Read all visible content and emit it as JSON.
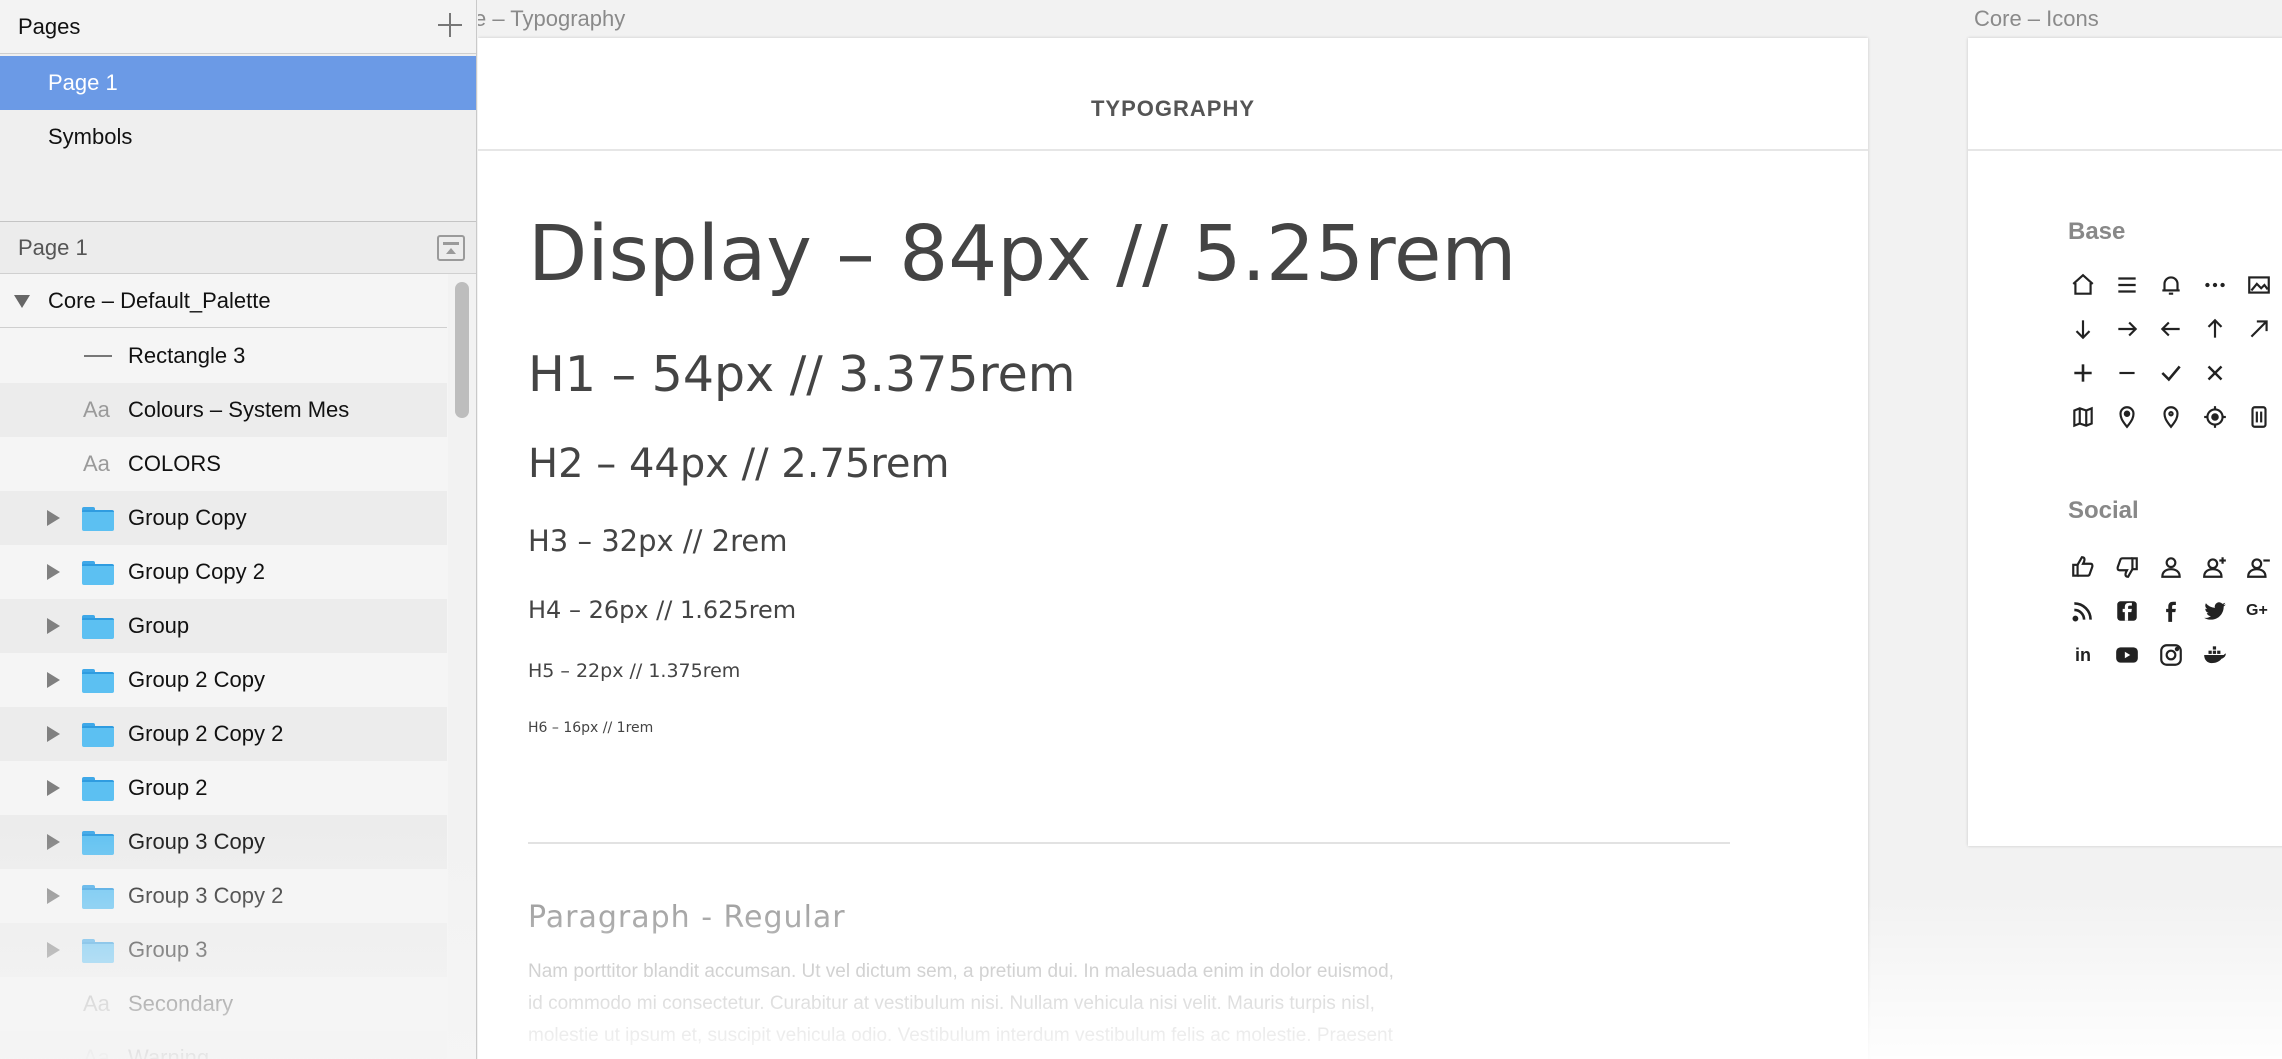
{
  "pages_panel": {
    "title": "Pages",
    "pages": [
      {
        "label": "Page 1",
        "selected": true
      },
      {
        "label": "Symbols",
        "selected": false
      }
    ]
  },
  "layers_panel": {
    "title": "Page 1",
    "artboard": "Core – Default_Palette",
    "layers": [
      {
        "label": "Rectangle 3",
        "type": "shape"
      },
      {
        "label": "Colours – System Mes",
        "type": "text"
      },
      {
        "label": "COLORS",
        "type": "text"
      },
      {
        "label": "Group Copy",
        "type": "group"
      },
      {
        "label": "Group Copy 2",
        "type": "group"
      },
      {
        "label": "Group",
        "type": "group"
      },
      {
        "label": "Group 2 Copy",
        "type": "group"
      },
      {
        "label": "Group 2 Copy 2",
        "type": "group"
      },
      {
        "label": "Group 2",
        "type": "group"
      },
      {
        "label": "Group 3 Copy",
        "type": "group"
      },
      {
        "label": "Group 3 Copy 2",
        "type": "group"
      },
      {
        "label": "Group 3",
        "type": "group"
      },
      {
        "label": "Secondary",
        "type": "text"
      },
      {
        "label": "Warning",
        "type": "text"
      }
    ],
    "text_icon_glyph": "Aa"
  },
  "canvas": {
    "typography_label": "e – Typography",
    "icons_label": "Core – Icons",
    "typography": {
      "header": "TYPOGRAPHY",
      "display": "Display – 84px // 5.25rem",
      "h1": "H1 – 54px // 3.375rem",
      "h2": "H2 – 44px // 2.75rem",
      "h3": "H3 – 32px // 2rem",
      "h4": "H4 – 26px // 1.625rem",
      "h5": "H5 – 22px // 1.375rem",
      "h6": "H6 – 16px // 1rem",
      "paragraph_title": "Paragraph - Regular",
      "paragraph_lines": [
        "Nam porttitor blandit accumsan. Ut vel dictum sem, a pretium dui. In malesuada enim in dolor euismod,",
        "id commodo mi consectetur. Curabitur at vestibulum nisi. Nullam vehicula nisi velit. Mauris turpis nisl,",
        "molestie ut ipsum et, suscipit vehicula odio. Vestibulum interdum vestibulum felis ac molestie. Praesent"
      ]
    },
    "icons": {
      "base_title": "Base",
      "social_title": "Social",
      "base_icons": [
        [
          "home-icon",
          "menu-icon",
          "bell-icon",
          "more-icon",
          "image-icon"
        ],
        [
          "arrow-down-icon",
          "arrow-right-icon",
          "arrow-left-icon",
          "arrow-up-icon",
          "arrow-up-right-icon"
        ],
        [
          "plus-icon",
          "minus-icon",
          "check-icon",
          "close-icon"
        ],
        [
          "map-icon",
          "location-pin-icon",
          "location-pin-outline-icon",
          "target-icon",
          "building-icon"
        ]
      ],
      "social_icons": [
        [
          "thumbs-up-icon",
          "thumbs-down-icon",
          "user-icon",
          "user-add-icon",
          "user-remove-icon"
        ],
        [
          "rss-icon",
          "facebook-square-icon",
          "facebook-icon",
          "twitter-icon",
          "google-plus-icon"
        ],
        [
          "linkedin-icon",
          "youtube-icon",
          "instagram-icon",
          "docker-icon"
        ]
      ],
      "google_plus_glyph": "G+",
      "linkedin_glyph": "in"
    }
  }
}
